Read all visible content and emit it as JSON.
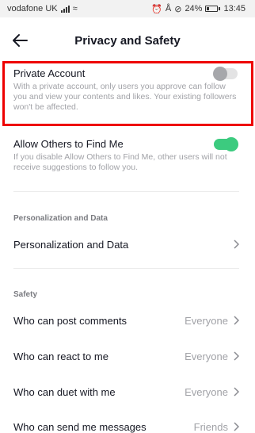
{
  "status_bar": {
    "carrier": "vodafone UK",
    "battery": "24%",
    "battery_level": 0.24,
    "time": "13:45",
    "icons": [
      "signal-icon",
      "wifi-icon",
      "alarm-icon",
      "bluetooth-icon",
      "mute-icon",
      "battery-icon"
    ]
  },
  "header": {
    "title": "Privacy and Safety",
    "back_icon": "arrow-left-icon"
  },
  "private_account": {
    "title": "Private Account",
    "description": "With a private account, only users you approve can follow you and view your contents and likes. Your existing followers won't be affected.",
    "toggle": "off"
  },
  "find_me": {
    "title": "Allow Others to Find Me",
    "description": "If you disable Allow Others to Find Me, other users will not receive suggestions to follow you.",
    "toggle": "on"
  },
  "personalization": {
    "section_label": "Personalization and Data",
    "row_label": "Personalization and Data"
  },
  "safety": {
    "section_label": "Safety",
    "rows": [
      {
        "label": "Who can post comments",
        "value": "Everyone"
      },
      {
        "label": "Who can react to me",
        "value": "Everyone"
      },
      {
        "label": "Who can duet with me",
        "value": "Everyone"
      },
      {
        "label": "Who can send me messages",
        "value": "Friends"
      }
    ]
  },
  "colors": {
    "highlight": "#ee0000",
    "toggle_on": "#3ccb7f",
    "toggle_off": "#e3e3e4",
    "secondary_text": "#a1a2a7"
  }
}
